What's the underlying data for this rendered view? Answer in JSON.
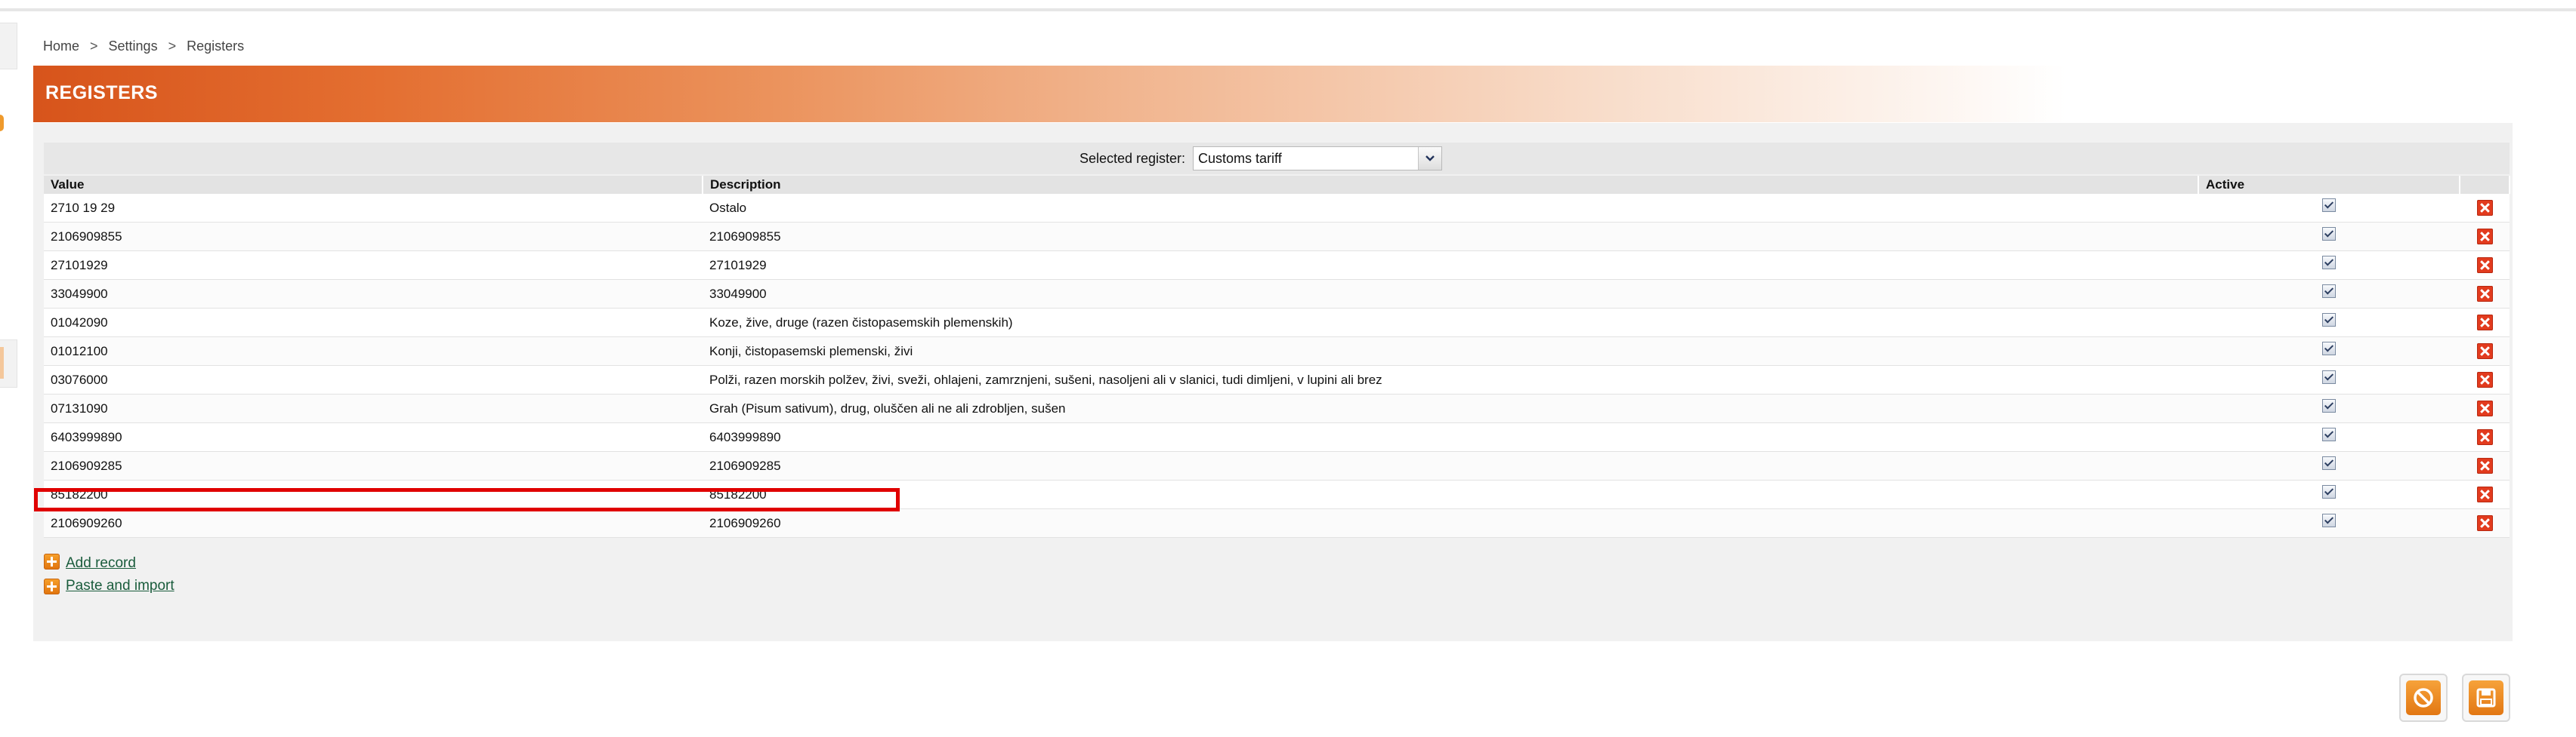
{
  "breadcrumb": {
    "items": [
      "Home",
      "Settings",
      "Registers"
    ],
    "separator": ">"
  },
  "page": {
    "title": "REGISTERS"
  },
  "selector": {
    "label": "Selected register:",
    "value": "Customs tariff"
  },
  "table": {
    "columns": [
      "Value",
      "Description",
      "Active",
      ""
    ],
    "rows": [
      {
        "value": "2710 19 29",
        "description": "Ostalo",
        "active": true
      },
      {
        "value": "2106909855",
        "description": "2106909855",
        "active": true
      },
      {
        "value": "27101929",
        "description": "27101929",
        "active": true
      },
      {
        "value": "33049900",
        "description": "33049900",
        "active": true
      },
      {
        "value": "01042090",
        "description": "Koze, žive, druge (razen čistopasemskih plemenskih)",
        "active": true
      },
      {
        "value": "01012100",
        "description": "Konji, čistopasemski plemenski, živi",
        "active": true
      },
      {
        "value": "03076000",
        "description": "Polži, razen morskih polžev, živi, sveži, ohlajeni, zamrznjeni, sušeni, nasoljeni ali v slanici, tudi dimljeni, v lupini ali brez",
        "active": true
      },
      {
        "value": "07131090",
        "description": "Grah (Pisum sativum), drug, oluščen ali ne ali zdrobljen, sušen",
        "active": true
      },
      {
        "value": "6403999890",
        "description": "6403999890",
        "active": true
      },
      {
        "value": "2106909285",
        "description": "2106909285",
        "active": true
      },
      {
        "value": "85182200",
        "description": "85182200",
        "active": true
      },
      {
        "value": "2106909260",
        "description": "2106909260",
        "active": true
      }
    ]
  },
  "actions": {
    "add_record": "Add record",
    "paste_import": "Paste and import"
  },
  "colors": {
    "accent": "#d7541b",
    "highlight": "#e00000",
    "link": "#1a5c3c"
  },
  "icons": {
    "add": "plus-icon",
    "delete": "delete-icon",
    "cancel": "cancel-icon",
    "save": "save-icon",
    "dropdown": "chevron-down-icon"
  }
}
